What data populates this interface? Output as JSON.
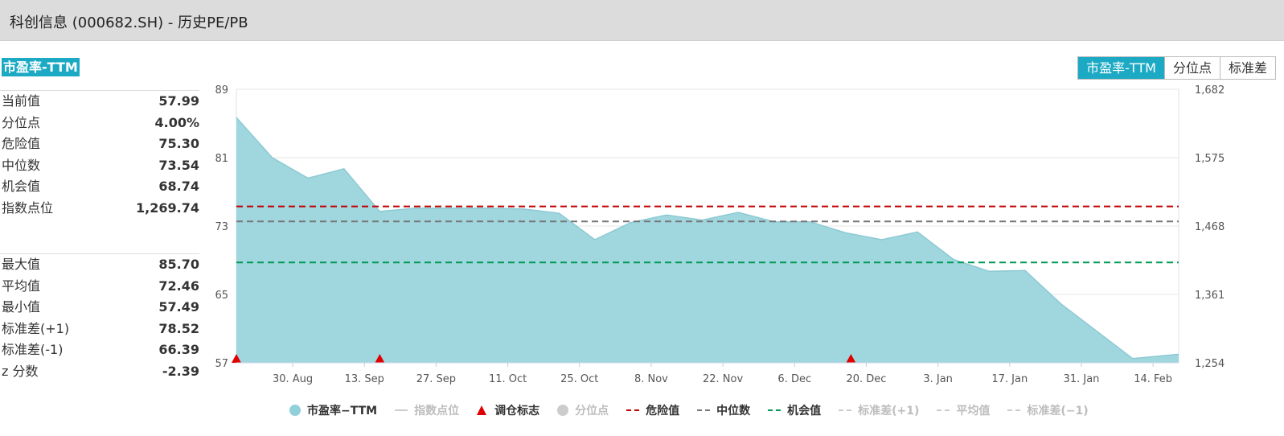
{
  "window": {
    "title": "科创信息 (000682.SH) - 历史PE/PB"
  },
  "section_tag": "市盈率-TTM",
  "tabs": [
    {
      "label": "市盈率-TTM",
      "active": true
    },
    {
      "label": "分位点",
      "active": false
    },
    {
      "label": "标准差",
      "active": false
    }
  ],
  "stats_group1": [
    {
      "label": "当前值",
      "value": "57.99"
    },
    {
      "label": "分位点",
      "value": "4.00%"
    },
    {
      "label": "危险值",
      "value": "75.30"
    },
    {
      "label": "中位数",
      "value": "73.54"
    },
    {
      "label": "机会值",
      "value": "68.74"
    },
    {
      "label": "指数点位",
      "value": "1,269.74"
    }
  ],
  "stats_group2": [
    {
      "label": "最大值",
      "value": "85.70"
    },
    {
      "label": "平均值",
      "value": "72.46"
    },
    {
      "label": "最小值",
      "value": "57.49"
    },
    {
      "label": "标准差(+1)",
      "value": "78.52"
    },
    {
      "label": "标准差(-1)",
      "value": "66.39"
    },
    {
      "label": "z 分数",
      "value": "-2.39"
    }
  ],
  "legend": [
    {
      "label": "市盈率−TTM",
      "kind": "dot",
      "color": "#8fd0da",
      "active": true
    },
    {
      "label": "指数点位",
      "kind": "line",
      "color": "#cccccc",
      "active": false
    },
    {
      "label": "调仓标志",
      "kind": "triangle",
      "color": "#e00000",
      "active": true
    },
    {
      "label": "分位点",
      "kind": "dot",
      "color": "#cccccc",
      "active": false
    },
    {
      "label": "危险值",
      "kind": "dash",
      "color": "#c00000",
      "active": true
    },
    {
      "label": "中位数",
      "kind": "dash",
      "color": "#777777",
      "active": true
    },
    {
      "label": "机会值",
      "kind": "dash",
      "color": "#009955",
      "active": true
    },
    {
      "label": "标准差(+1)",
      "kind": "dash",
      "color": "#cccccc",
      "active": false
    },
    {
      "label": "平均值",
      "kind": "dash",
      "color": "#cccccc",
      "active": false
    },
    {
      "label": "标准差(−1)",
      "kind": "dash",
      "color": "#cccccc",
      "active": false
    }
  ],
  "chart_data": {
    "type": "area",
    "x_tick_labels": [
      "30. Aug",
      "13. Sep",
      "27. Sep",
      "11. Oct",
      "25. Oct",
      "8. Nov",
      "22. Nov",
      "6. Dec",
      "20. Dec",
      "3. Jan",
      "17. Jan",
      "31. Jan",
      "14. Feb"
    ],
    "y_left_ticks": [
      "57",
      "65",
      "73",
      "81",
      "89"
    ],
    "y_right_ticks": [
      "1,254",
      "1,361",
      "1,468",
      "1,575",
      "1,682"
    ],
    "ylim_left": [
      57,
      89
    ],
    "ylim_right": [
      1254,
      1682
    ],
    "xlim": [
      "2024-08-19",
      "2025-02-19"
    ],
    "series": [
      {
        "name": "市盈率−TTM",
        "color": "#a0d7df",
        "points": [
          [
            "2024-08-19",
            85.7
          ],
          [
            "2024-08-26",
            81.0
          ],
          [
            "2024-09-02",
            78.6
          ],
          [
            "2024-09-09",
            79.7
          ],
          [
            "2024-09-16",
            74.7
          ],
          [
            "2024-09-23",
            75.1
          ],
          [
            "2024-09-30",
            75.1
          ],
          [
            "2024-10-07",
            75.1
          ],
          [
            "2024-10-14",
            75.0
          ],
          [
            "2024-10-21",
            74.5
          ],
          [
            "2024-10-28",
            71.4
          ],
          [
            "2024-11-04",
            73.4
          ],
          [
            "2024-11-11",
            74.3
          ],
          [
            "2024-11-18",
            73.7
          ],
          [
            "2024-11-25",
            74.6
          ],
          [
            "2024-12-02",
            73.5
          ],
          [
            "2024-12-09",
            73.5
          ],
          [
            "2024-12-16",
            72.2
          ],
          [
            "2024-12-23",
            71.4
          ],
          [
            "2024-12-30",
            72.3
          ],
          [
            "2025-01-06",
            69.1
          ],
          [
            "2025-01-13",
            67.7
          ],
          [
            "2025-01-20",
            67.8
          ],
          [
            "2025-01-27",
            63.9
          ],
          [
            "2025-02-03",
            60.7
          ],
          [
            "2025-02-10",
            57.5
          ],
          [
            "2025-02-19",
            58.0
          ]
        ]
      }
    ],
    "reference_lines": [
      {
        "name": "危险值",
        "value": 75.3,
        "color": "#c00000"
      },
      {
        "name": "中位数",
        "value": 73.54,
        "color": "#777777"
      },
      {
        "name": "机会值",
        "value": 68.74,
        "color": "#009955"
      }
    ],
    "rebalance_markers": [
      "2024-08-19",
      "2024-09-16",
      "2024-12-17"
    ],
    "grid": true
  }
}
